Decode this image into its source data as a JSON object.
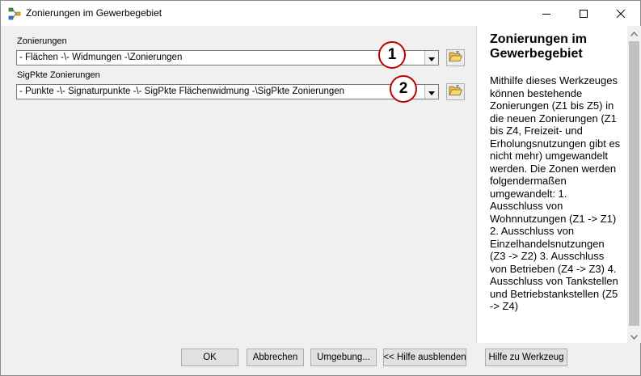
{
  "window": {
    "title": "Zonierungen im Gewerbegebiet",
    "icons": {
      "app": "toolbox-model-icon",
      "minimize": "minimize-icon",
      "maximize": "maximize-icon",
      "close": "close-icon"
    }
  },
  "form": {
    "fields": [
      {
        "label": "Zonierungen",
        "value": "- Flächen -\\- Widmungen -\\Zonierungen",
        "callout": "1",
        "browse_icon": "open-folder-icon"
      },
      {
        "label": "SigPkte Zonierungen",
        "value": "- Punkte -\\- Signaturpunkte -\\- SigPkte Flächenwidmung -\\SigPkte Zonierungen",
        "callout": "2",
        "browse_icon": "open-folder-icon"
      }
    ]
  },
  "help": {
    "title": "Zonierungen im Gewerbegebiet",
    "body": "Mithilfe dieses Werkzeuges können bestehende Zonierungen (Z1 bis Z5) in die neuen Zonierungen (Z1 bis Z4, Freizeit- und Erholungsnutzungen gibt es nicht mehr) umgewandelt werden. Die Zonen werden folgendermaßen umgewandelt: 1. Ausschluss von Wohnnutzungen (Z1 -> Z1) 2. Ausschluss von Einzelhandelsnutzungen (Z3 -> Z2) 3. Ausschluss von Betrieben (Z4 -> Z3) 4. Ausschluss von Tankstellen und Betriebstankstellen (Z5 -> Z4)"
  },
  "buttons": {
    "ok": "OK",
    "cancel": "Abbrechen",
    "environments": "Umgebung...",
    "hide_help": "<< Hilfe ausblenden",
    "tool_help": "Hilfe zu Werkzeug"
  },
  "colors": {
    "callout_border": "#c00000",
    "window_bg": "#f0f0f0",
    "help_bg": "#ffffff"
  }
}
